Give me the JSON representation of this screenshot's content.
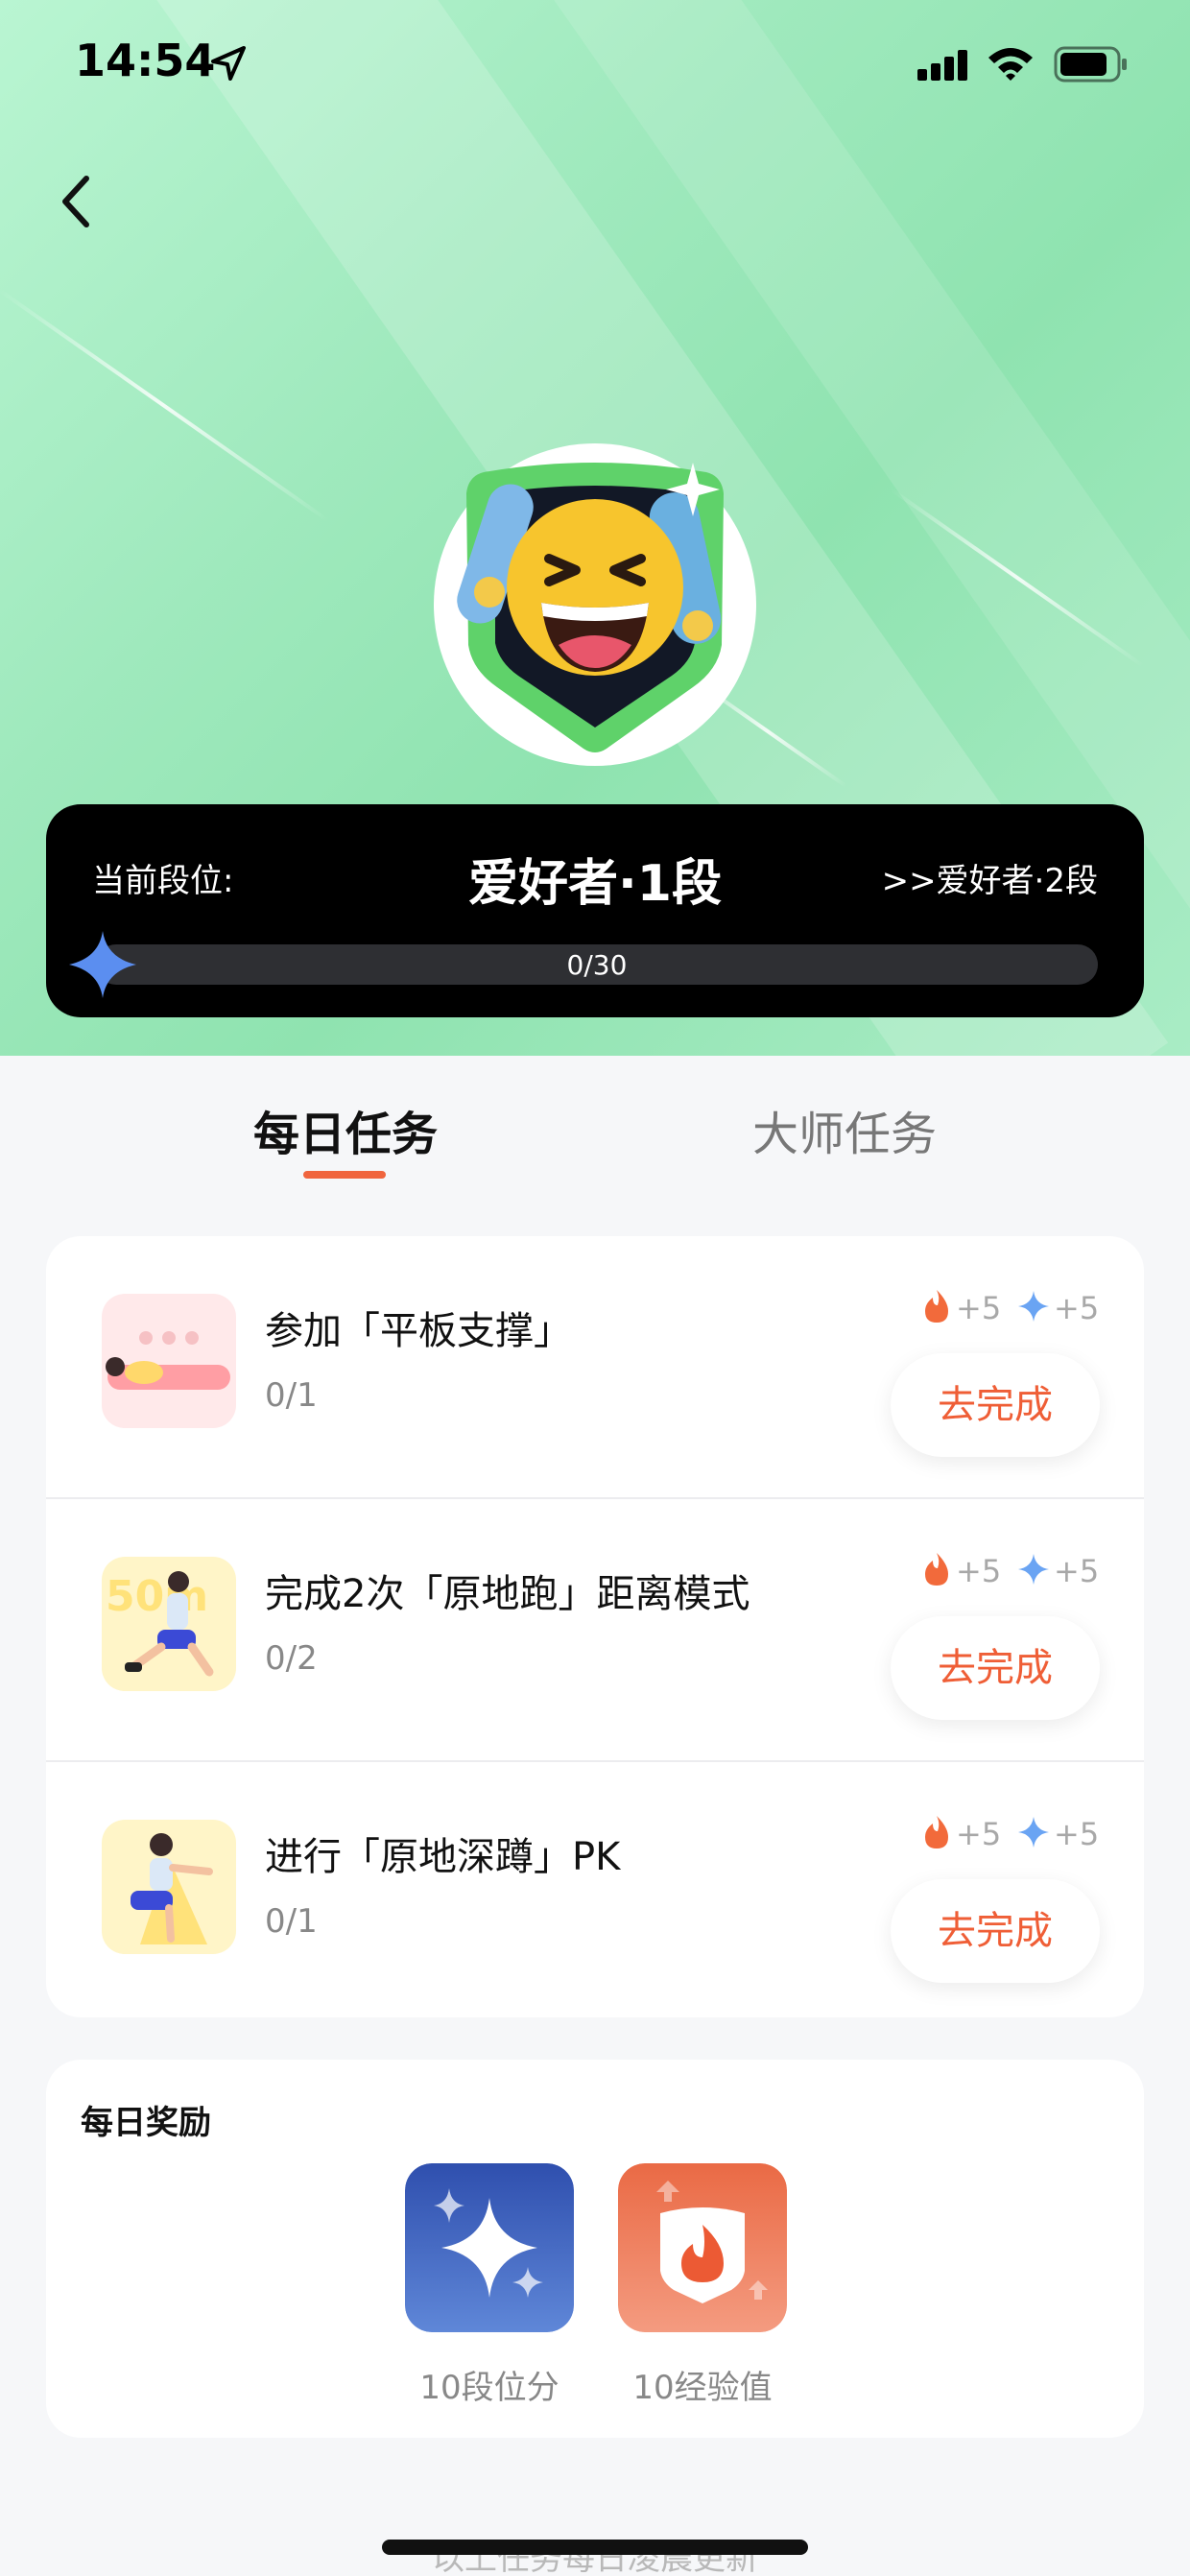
{
  "status_bar": {
    "time": "14:54"
  },
  "rank": {
    "label": "当前段位:",
    "title": "爱好者·1段",
    "next": ">>爱好者·2段",
    "progress_text": "0/30",
    "progress_fraction": 0.0
  },
  "tabs": [
    {
      "label": "每日任务",
      "active": true
    },
    {
      "label": "大师任务",
      "active": false
    }
  ],
  "tasks": [
    {
      "title": "参加「平板支撑」",
      "progress": "0/1",
      "fire_reward": "+5",
      "star_reward": "+5",
      "button": "去完成",
      "thumb_icon": "plank-illustration-icon"
    },
    {
      "title": "完成2次「原地跑」距离模式",
      "progress": "0/2",
      "fire_reward": "+5",
      "star_reward": "+5",
      "button": "去完成",
      "thumb_icon": "running-illustration-icon"
    },
    {
      "title": "进行「原地深蹲」PK",
      "progress": "0/1",
      "fire_reward": "+5",
      "star_reward": "+5",
      "button": "去完成",
      "thumb_icon": "squat-illustration-icon"
    }
  ],
  "daily_reward": {
    "heading": "每日奖励",
    "items": [
      {
        "label": "10段位分",
        "icon": "sparkle-icon"
      },
      {
        "label": "10经验值",
        "icon": "flame-shield-icon"
      }
    ]
  },
  "footer_note": "以上任务每日凌晨更新",
  "colors": {
    "accent": "#ef5e36",
    "hero_green": "#9fe9bd",
    "progress_blue": "#5b8ef0",
    "panel_black": "#000000"
  }
}
